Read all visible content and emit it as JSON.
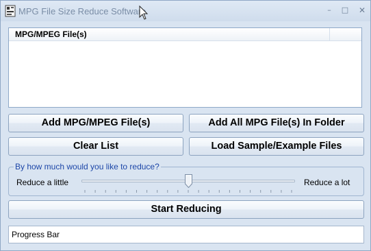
{
  "window": {
    "title": "MPG File Size Reduce Software",
    "minimize_glyph": "–",
    "maximize_glyph": "□",
    "close_glyph": "✕",
    "icon": "app-icon"
  },
  "file_list": {
    "column_header": "MPG/MPEG File(s)",
    "rows": []
  },
  "buttons": {
    "add_files": "Add MPG/MPEG File(s)",
    "add_folder": "Add All MPG File(s) In Folder",
    "clear_list": "Clear List",
    "load_samples": "Load Sample/Example Files",
    "start": "Start Reducing"
  },
  "reduce_group": {
    "title": "By how much would you like to reduce?",
    "min_label": "Reduce a little",
    "max_label": "Reduce a lot",
    "slider_value": 0.5,
    "tick_count": 21
  },
  "progress": {
    "label": "Progress Bar",
    "value": 0
  },
  "colors": {
    "accent_title": "#1c46a8",
    "window_bg": "#d9e4f1"
  }
}
